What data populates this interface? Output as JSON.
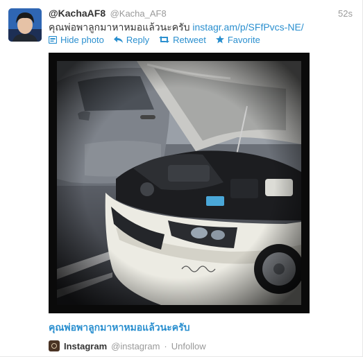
{
  "tweet": {
    "full_name": "@KachaAF8",
    "username": "@Kacha_AF8",
    "time": "52s",
    "text": "คุณพ่อพาลูกมาหาหมอแล้วนะครับ",
    "link": "instagr.am/p/SFfPvcs-NE/"
  },
  "actions": {
    "hide_photo": "Hide photo",
    "reply": "Reply",
    "retweet": "Retweet",
    "favorite": "Favorite"
  },
  "media": {
    "caption": "คุณพ่อพาลูกมาหาหมอแล้วนะครับ",
    "source_name": "Instagram",
    "source_handle": "@instagram",
    "separator": "·",
    "unfollow": "Unfollow"
  },
  "colors": {
    "link": "#2a8fcf",
    "muted": "#999999",
    "text": "#333333"
  },
  "icons": [
    "photo-icon",
    "reply-icon",
    "retweet-icon",
    "favorite-star-icon",
    "instagram-icon"
  ]
}
